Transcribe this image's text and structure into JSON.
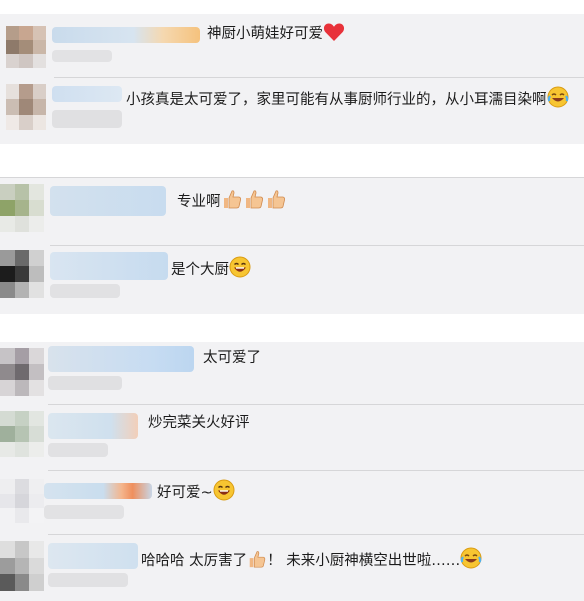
{
  "groups": [
    {
      "comments": [
        {
          "text": "神厨小萌娃好可爱",
          "emoji": [
            "heart-icon"
          ]
        },
        {
          "text": "小孩真是太可爱了，家里可能有从事厨师行业的，从小耳濡目染啊",
          "emoji": [
            "laughing-tears-icon"
          ]
        }
      ]
    },
    {
      "comments": [
        {
          "text": "专业啊",
          "emoji": [
            "thumbs-up-icon",
            "thumbs-up-icon",
            "thumbs-up-icon"
          ]
        },
        {
          "text": "是个大厨",
          "emoji": [
            "laughing-icon"
          ]
        }
      ]
    },
    {
      "comments": [
        {
          "text": "太可爱了",
          "emoji": []
        },
        {
          "text": "炒完菜关火好评",
          "emoji": []
        },
        {
          "text": "好可爱~",
          "emoji": [
            "laughing-icon"
          ]
        },
        {
          "text_a": "哈哈哈 太厉害了",
          "text_b": "！ 未来小厨神横空出世啦……",
          "emoji": [
            "thumbs-up-icon",
            "laughing-tears-icon"
          ]
        }
      ]
    }
  ]
}
